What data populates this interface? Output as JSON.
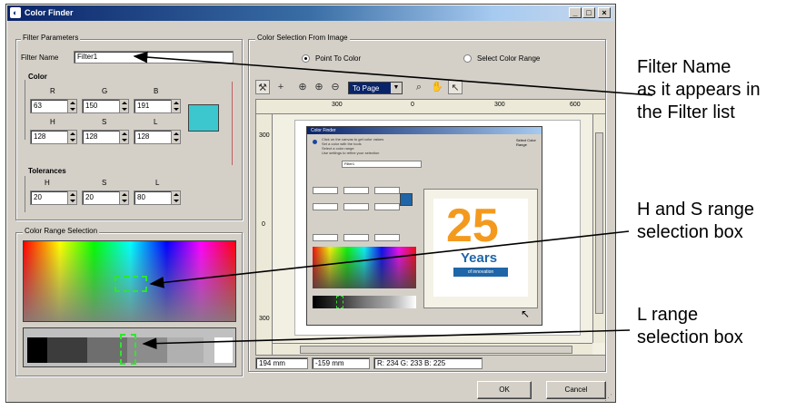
{
  "window": {
    "title": "Color Finder",
    "buttons": [
      "_",
      "□",
      "×"
    ]
  },
  "filter_parameters": {
    "group_label": "Filter Parameters",
    "filter_name_label": "Filter Name",
    "filter_name_value": "Filter1",
    "color_label": "Color",
    "rgb_labels": [
      "R",
      "G",
      "B"
    ],
    "rgb_values": [
      "63",
      "150",
      "191"
    ],
    "hsl_labels": [
      "H",
      "S",
      "L"
    ],
    "hsl_values": [
      "128",
      "128",
      "128"
    ],
    "swatch_color": "#3cc7cf",
    "tolerances_label": "Tolerances",
    "tol_labels": [
      "H",
      "S",
      "L"
    ],
    "tol_values": [
      "20",
      "20",
      "80"
    ]
  },
  "color_range": {
    "group_label": "Color Range Selection"
  },
  "color_selection": {
    "group_label": "Color Selection From Image",
    "radio_point": "Point To Color",
    "radio_range": "Select Color Range",
    "zoom_select": "To Page"
  },
  "ruler_top": [
    "300",
    "0",
    "300",
    "600"
  ],
  "ruler_left": [
    "300",
    "0",
    "300"
  ],
  "nested": {
    "title": "Color Finder",
    "filter_name": "Filter1",
    "lines": [
      "Click on the canvas to get color values",
      "Set a color with the tools",
      "Select a color range",
      "Use settings to refine your selection"
    ],
    "radio_label": "Select Color Range",
    "year_number": "25",
    "year_word": "Years",
    "year_sub": "of innovation"
  },
  "status_bar": {
    "x": "194 mm",
    "y": "-159 mm",
    "rgb": "R: 234 G: 233 B: 225"
  },
  "buttons": {
    "ok": "OK",
    "cancel": "Cancel"
  },
  "callouts": {
    "filter_name": [
      "Filter Name",
      "as it appears in",
      "the Filter list"
    ],
    "hs_range": [
      "H and S range",
      "selection box"
    ],
    "l_range": [
      "L range",
      "selection box"
    ]
  }
}
